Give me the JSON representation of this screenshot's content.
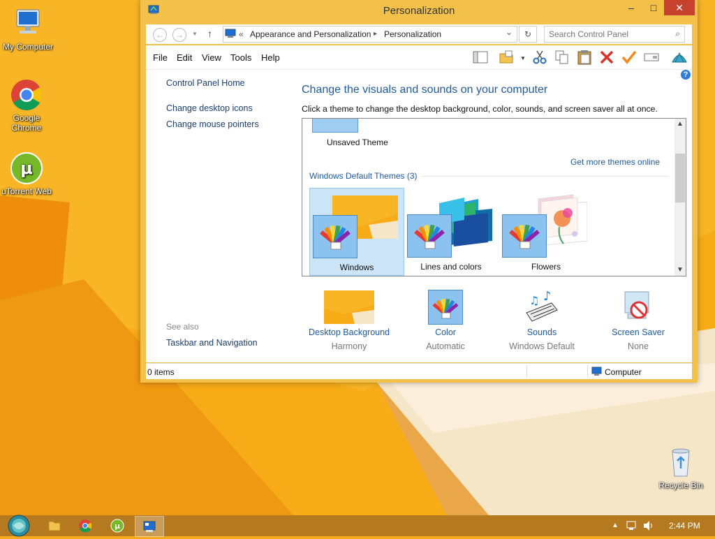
{
  "desktop": {
    "icons": [
      {
        "label": "My Computer"
      },
      {
        "label": "Google Chrome"
      },
      {
        "label": "uTorrent Web"
      },
      {
        "label": "Recycle Bin"
      }
    ]
  },
  "window": {
    "title": "Personalization",
    "controls": {
      "minimize": "–",
      "maximize": "□",
      "close": "✕"
    },
    "address": {
      "back": "←",
      "forward": "→",
      "up": "↑",
      "prefix": "«",
      "crumb1": "Appearance and Personalization",
      "sep": "▸",
      "crumb2": "Personalization",
      "dropdown": "⌄",
      "refresh": "↻"
    },
    "search": {
      "placeholder": "Search Control Panel",
      "icon": "⌕"
    },
    "menu": [
      "File",
      "Edit",
      "View",
      "Tools",
      "Help"
    ],
    "sidebar": {
      "home": "Control Panel Home",
      "links": [
        "Change desktop icons",
        "Change mouse pointers"
      ],
      "see_also": "See also",
      "see_also_links": [
        "Taskbar and Navigation"
      ]
    },
    "main": {
      "title": "Change the visuals and sounds on your computer",
      "description": "Click a theme to change the desktop background, color, sounds, and screen saver all at once.",
      "help": "?"
    },
    "themes": {
      "unsaved": "Unsaved Theme",
      "get_more": "Get more themes online",
      "group": "Windows Default Themes (3)",
      "items": [
        {
          "label": "Windows",
          "selected": true
        },
        {
          "label": "Lines and colors",
          "selected": false
        },
        {
          "label": "Flowers",
          "selected": false
        }
      ]
    },
    "settings": [
      {
        "link": "Desktop Background",
        "value": "Harmony"
      },
      {
        "link": "Color",
        "value": "Automatic"
      },
      {
        "link": "Sounds",
        "value": "Windows Default"
      },
      {
        "link": "Screen Saver",
        "value": "None"
      }
    ],
    "status": {
      "items": "0 items",
      "location": "Computer"
    }
  },
  "taskbar": {
    "clock": "2:44 PM"
  },
  "colors": {
    "wallpaper_orange": "#f5a91b",
    "window_frame": "#f3c04a",
    "link_blue": "#1e5a9e",
    "close_red": "#c7412f",
    "selection": "#cce4f7"
  }
}
